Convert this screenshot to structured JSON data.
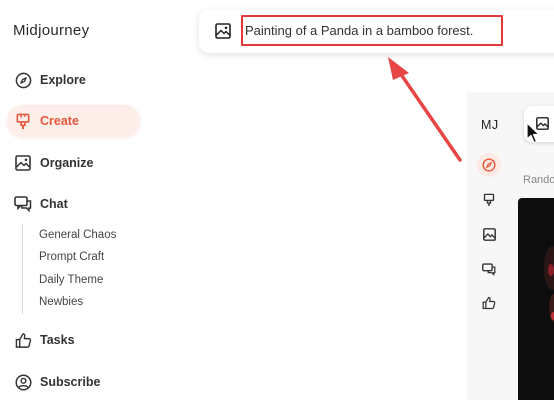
{
  "brand": "Midjourney",
  "sidebar": {
    "items": [
      {
        "label": "Explore",
        "icon": "compass-icon"
      },
      {
        "label": "Create",
        "icon": "paintbrush-icon",
        "active": true
      },
      {
        "label": "Organize",
        "icon": "image-icon"
      },
      {
        "label": "Chat",
        "icon": "chat-icon"
      },
      {
        "label": "Tasks",
        "icon": "thumbs-up-icon"
      },
      {
        "label": "Subscribe",
        "icon": "user-circle-icon"
      }
    ],
    "chat_channels": [
      "General Chaos",
      "Prompt Craft",
      "Daily Theme",
      "Newbies"
    ]
  },
  "prompt": {
    "icon": "image-icon",
    "value": "Painting of a Panda in a bamboo forest."
  },
  "inner_view": {
    "logo": "MJ",
    "random_label": "Rando"
  },
  "colors": {
    "accent": "#e8583b",
    "highlight_border": "#e23a3a",
    "annotation_arrow": "#e84545"
  }
}
